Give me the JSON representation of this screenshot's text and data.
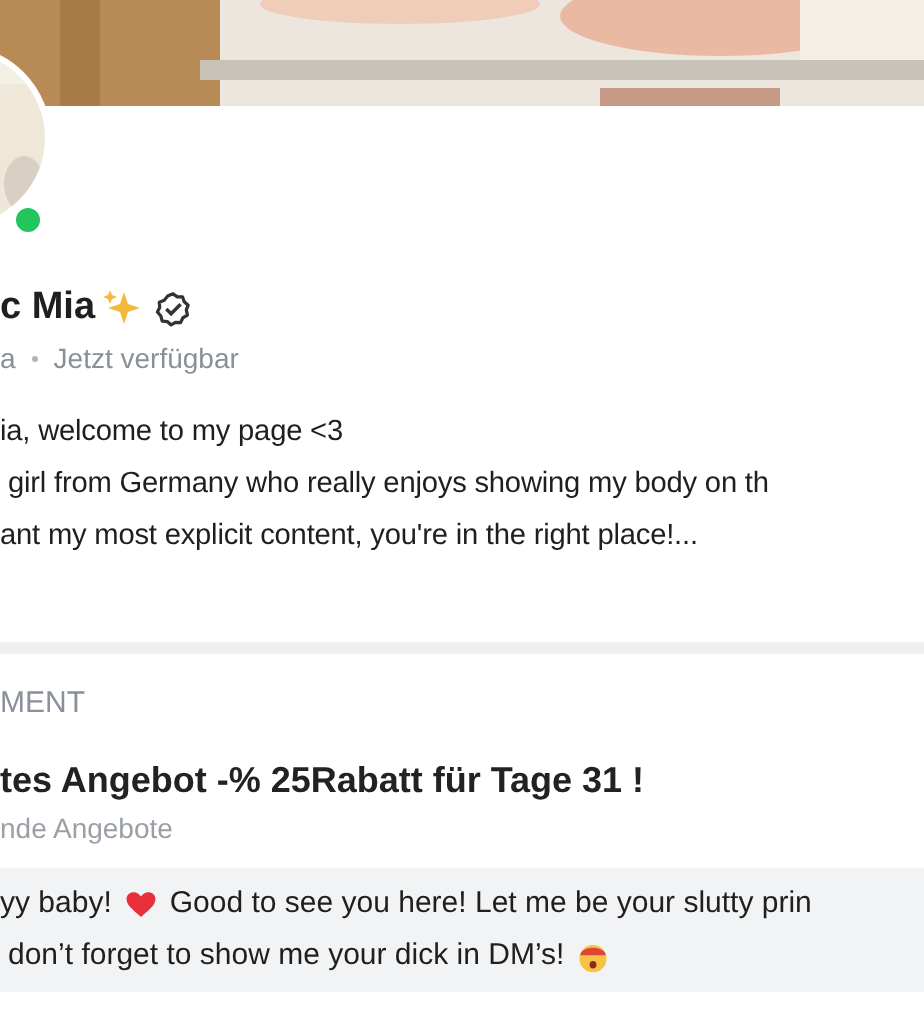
{
  "profile": {
    "online": true,
    "name": "c Mia",
    "verified": true,
    "handle": "a",
    "status": "Jetzt verfügbar"
  },
  "bio": [
    "ia, welcome to my page <3",
    "girl from Germany who really enjoys showing my body on th",
    "ant my most explicit content, you're in the right place!..."
  ],
  "section": {
    "heading": "MENT"
  },
  "offer": {
    "title": "tes Angebot -% 25Rabatt für Tage 31 !",
    "subtitle": "nde Angebote"
  },
  "message": {
    "line_1_start": "yy baby!",
    "line_1_end": "Good to see you here! Let me be your slutty prin",
    "line_2": "don’t forget to show me your dick in DM’s!"
  }
}
